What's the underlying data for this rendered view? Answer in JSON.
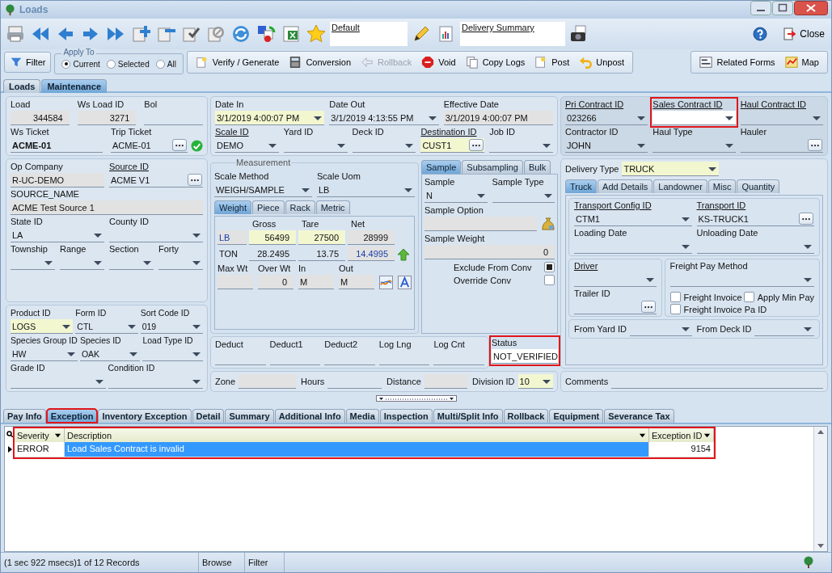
{
  "window": {
    "title": "Loads"
  },
  "toolbar": {
    "layout_field": {
      "value": "Default"
    },
    "report_field": {
      "value": "Delivery Summary"
    },
    "close_label": "Close"
  },
  "actions": {
    "filter": "Filter",
    "apply_to": {
      "title": "Apply To",
      "options": [
        {
          "label": "Current",
          "selected": true
        },
        {
          "label": "Selected",
          "selected": false
        },
        {
          "label": "All",
          "selected": false
        }
      ]
    },
    "buttons": [
      {
        "label": "Verify / Generate",
        "disabled": false
      },
      {
        "label": "Conversion",
        "disabled": false
      },
      {
        "label": "Rollback",
        "disabled": true
      },
      {
        "label": "Void",
        "disabled": false
      },
      {
        "label": "Copy Logs",
        "disabled": false
      },
      {
        "label": "Post",
        "disabled": false
      },
      {
        "label": "Unpost",
        "disabled": false
      }
    ],
    "side_buttons": [
      "Related Forms",
      "Map"
    ]
  },
  "main_tabs": [
    {
      "label": "Loads",
      "selected": false
    },
    {
      "label": "Maintenance",
      "selected": true
    }
  ],
  "left_panels": [
    {
      "rows": [
        {
          "fields": [
            {
              "label": "Load",
              "value": "344584",
              "kind": "text",
              "readonly": true,
              "numeric": true
            },
            {
              "label": "Ws Load ID",
              "value": "3271",
              "kind": "text",
              "readonly": true,
              "numeric": true
            },
            {
              "label": "Bol",
              "kind": "text"
            }
          ]
        },
        {
          "fields": [
            {
              "label": "Ws Ticket",
              "value": "ACME-01",
              "kind": "text",
              "bold": true
            },
            {
              "label": "Trip Ticket",
              "value": "ACME-01",
              "kind": "lookup",
              "verified": true
            }
          ]
        }
      ]
    },
    {
      "rows": [
        {
          "fields": [
            {
              "label": "Op Company",
              "value": "R-UC-DEMO",
              "kind": "text",
              "readonly": true
            },
            {
              "label": "Source ID",
              "link": true,
              "value": "ACME V1",
              "kind": "lookup"
            }
          ]
        },
        {
          "fields": [
            {
              "label": "SOURCE_NAME",
              "value": "ACME Test Source 1",
              "kind": "text",
              "readonly": true
            }
          ]
        },
        {
          "fields": [
            {
              "label": "State ID",
              "value": "LA",
              "kind": "combo"
            },
            {
              "label": "County ID",
              "kind": "combo"
            }
          ]
        },
        {
          "fields": [
            {
              "label": "Township",
              "kind": "combo"
            },
            {
              "label": "Range",
              "kind": "combo"
            },
            {
              "label": "Section",
              "kind": "combo"
            },
            {
              "label": "Forty",
              "kind": "combo"
            }
          ]
        }
      ]
    },
    {
      "rows": [
        {
          "fields": [
            {
              "label": "Product ID",
              "value": "LOGS",
              "kind": "combo",
              "required": true
            },
            {
              "label": "Form ID",
              "value": "CTL",
              "kind": "combo"
            },
            {
              "label": "Sort Code ID",
              "value": "019",
              "kind": "combo"
            }
          ]
        },
        {
          "fields": [
            {
              "label": "Species Group ID",
              "value": "HW",
              "kind": "combo"
            },
            {
              "label": "Species ID",
              "value": "OAK",
              "kind": "combo"
            },
            {
              "label": "Load Type ID",
              "kind": "combo"
            }
          ]
        },
        {
          "fields": [
            {
              "label": "Grade ID",
              "kind": "combo"
            },
            {
              "label": "Condition ID",
              "kind": "combo"
            }
          ]
        }
      ]
    }
  ],
  "dates_panel": {
    "rows": [
      {
        "fields": [
          {
            "label": "Date In",
            "value": "3/1/2019 4:00:07 PM",
            "kind": "combo",
            "required": true
          },
          {
            "label": "Date Out",
            "value": "3/1/2019 4:13:55 PM",
            "kind": "combo"
          },
          {
            "label": "Effective Date",
            "value": "3/1/2019 4:00:07 PM",
            "kind": "text",
            "readonly": true
          }
        ]
      },
      {
        "fields": [
          {
            "label": "Scale ID",
            "link": true,
            "value": "DEMO",
            "kind": "combo"
          },
          {
            "label": "Yard ID",
            "kind": "combo"
          },
          {
            "label": "Deck ID",
            "kind": "combo"
          },
          {
            "label": "Destination ID",
            "link": true,
            "value": "CUST1",
            "kind": "lookup",
            "required": true
          },
          {
            "label": "Job ID",
            "kind": "combo"
          }
        ]
      }
    ]
  },
  "measurement": {
    "legend": "Measurement",
    "fields": [
      {
        "label": "Scale Method",
        "value": "WEIGH/SAMPLE",
        "kind": "combo"
      },
      {
        "label": "Scale Uom",
        "value": "LB",
        "kind": "combo"
      }
    ],
    "tabs": [
      {
        "label": "Weight",
        "selected": true
      },
      {
        "label": "Piece",
        "selected": false
      },
      {
        "label": "Rack",
        "selected": false
      },
      {
        "label": "Metric",
        "selected": false
      }
    ],
    "columns": [
      "Gross",
      "Tare",
      "Net"
    ],
    "lines": [
      {
        "unit": {
          "value": "LB",
          "kind": "text",
          "readonly": true,
          "accent": true
        },
        "cells": [
          {
            "value": "56499",
            "kind": "text",
            "required": true,
            "numeric": true
          },
          {
            "value": "27500",
            "kind": "text",
            "required": true,
            "numeric": true
          },
          {
            "value": "28999",
            "kind": "text",
            "readonly": true,
            "numeric": true
          }
        ]
      },
      {
        "unit": {
          "value": "TON"
        },
        "cells": [
          {
            "value": "28.2495",
            "kind": "text",
            "numeric": true
          },
          {
            "value": "13.75",
            "kind": "text",
            "numeric": true
          },
          {
            "value": "14.4995",
            "kind": "text",
            "readonly": true,
            "numeric": true,
            "accent": true
          }
        ]
      }
    ],
    "limits": [
      {
        "label": "Max Wt",
        "kind": "text",
        "readonly": true
      },
      {
        "label": "Over Wt",
        "value": "0",
        "kind": "text",
        "readonly": true,
        "numeric": true
      },
      {
        "label": "In",
        "value": "M",
        "kind": "text",
        "readonly": true
      },
      {
        "label": "Out",
        "value": "M",
        "kind": "text",
        "readonly": true
      }
    ]
  },
  "sample": {
    "tabs": [
      {
        "label": "Sample",
        "selected": true
      },
      {
        "label": "Subsampling",
        "selected": false
      },
      {
        "label": "Bulk",
        "selected": false
      }
    ],
    "rows": [
      {
        "fields": [
          {
            "label": "Sample",
            "value": "N",
            "kind": "combo"
          },
          {
            "label": "Sample Type",
            "kind": "combo"
          }
        ]
      },
      {
        "fields": [
          {
            "label": "Sample Option",
            "kind": "text",
            "readonly": true
          }
        ]
      },
      {
        "fields": [
          {
            "label": "Sample Weight",
            "value": "0",
            "kind": "text",
            "readonly": true,
            "numeric": true
          }
        ]
      }
    ],
    "checks": [
      {
        "label": "Exclude From Conv",
        "checked": true
      },
      {
        "label": "Override Conv",
        "checked": false
      }
    ]
  },
  "deduct_row": [
    {
      "label": "Deduct",
      "kind": "text"
    },
    {
      "label": "Deduct1",
      "kind": "text"
    },
    {
      "label": "Deduct2",
      "kind": "text"
    },
    {
      "label": "Log Lng",
      "kind": "text"
    },
    {
      "label": "Log Cnt",
      "kind": "text"
    }
  ],
  "status": {
    "label": "Status",
    "value": "NOT_VERIFIED",
    "kind": "text",
    "highlighted": true
  },
  "zone_row": [
    {
      "label": "Zone",
      "kind": "text",
      "readonly": true
    },
    {
      "label": "Hours",
      "kind": "text"
    },
    {
      "label": "Distance",
      "kind": "text",
      "readonly": true
    },
    {
      "label": "Division ID",
      "value": "10",
      "kind": "combo",
      "required": true
    }
  ],
  "contracts_panel": {
    "rows": [
      {
        "fields": [
          {
            "label": "Pri Contract ID",
            "link": true,
            "value": "023266",
            "kind": "combo"
          },
          {
            "label": "Sales Contract ID",
            "link": true,
            "kind": "combo",
            "highlighted": true
          },
          {
            "label": "Haul Contract ID",
            "link": true,
            "kind": "combo"
          }
        ]
      },
      {
        "fields": [
          {
            "label": "Contractor ID",
            "value": "JOHN",
            "kind": "combo"
          },
          {
            "label": "Haul Type",
            "kind": "combo"
          },
          {
            "label": "Hauler",
            "kind": "lookup"
          }
        ]
      }
    ]
  },
  "delivery": {
    "type": {
      "label": "Delivery Type",
      "value": "TRUCK",
      "kind": "combo",
      "required": true
    },
    "tabs": [
      {
        "label": "Truck",
        "selected": true
      },
      {
        "label": "Add Details",
        "selected": false
      },
      {
        "label": "Landowner",
        "selected": false
      },
      {
        "label": "Misc",
        "selected": false
      },
      {
        "label": "Quantity",
        "selected": false
      }
    ],
    "rows": [
      {
        "fields": [
          {
            "label": "Transport Config ID",
            "link": true,
            "value": "CTM1",
            "kind": "combo"
          },
          {
            "label": "Transport ID",
            "link": true,
            "value": "KS-TRUCK1",
            "kind": "lookup"
          }
        ]
      },
      {
        "fields": [
          {
            "label": "Loading Date",
            "kind": "combo"
          },
          {
            "label": "Unloading Date",
            "kind": "combo"
          }
        ]
      }
    ],
    "driver": [
      {
        "label": "Driver",
        "link": true,
        "kind": "combo"
      },
      {
        "label": "Trailer ID",
        "kind": "lookup"
      }
    ],
    "freight": {
      "field": {
        "label": "Freight Pay Method",
        "kind": "combo"
      },
      "checks": [
        {
          "label": "Freight Invoice",
          "checked": false
        },
        {
          "label": "Apply Min Pay",
          "checked": false
        },
        {
          "label": "Freight Invoice Pa ID",
          "checked": false
        }
      ]
    },
    "from_row": [
      {
        "label": "From Yard ID",
        "kind": "combo"
      },
      {
        "label": "From Deck ID",
        "kind": "combo"
      }
    ]
  },
  "comments": {
    "label": "Comments",
    "kind": "text"
  },
  "detail_tabs": [
    {
      "label": "Pay Info",
      "selected": false
    },
    {
      "label": "Exception",
      "selected": true,
      "highlighted": true
    },
    {
      "label": "Inventory Exception",
      "selected": false
    },
    {
      "label": "Detail",
      "selected": false
    },
    {
      "label": "Summary",
      "selected": false
    },
    {
      "label": "Additional Info",
      "selected": false
    },
    {
      "label": "Media",
      "selected": false
    },
    {
      "label": "Inspection",
      "selected": false
    },
    {
      "label": "Multi/Split Info",
      "selected": false
    },
    {
      "label": "Rollback",
      "selected": false
    },
    {
      "label": "Equipment",
      "selected": false
    },
    {
      "label": "Severance Tax",
      "selected": false
    }
  ],
  "grid": {
    "highlighted": true,
    "columns": [
      "Severity",
      "Description",
      "Exception ID"
    ],
    "rows": [
      {
        "selected": true,
        "cells": [
          "ERROR",
          "Load Sales Contract is invalid",
          "9154"
        ]
      }
    ]
  },
  "status_bar": [
    "(1 sec 922 msecs)1 of 12 Records",
    "Browse",
    "Filter"
  ]
}
